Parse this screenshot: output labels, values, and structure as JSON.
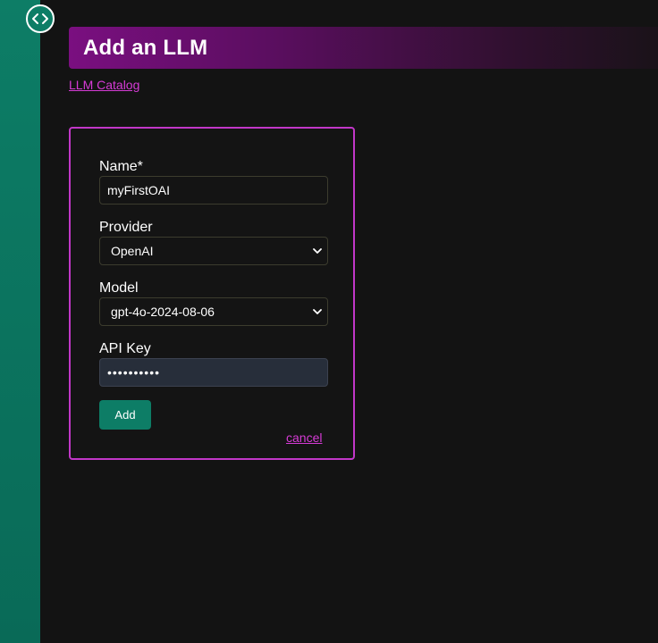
{
  "sidebar": {
    "toggle_icon": "code-brackets-icon"
  },
  "header": {
    "title": "Add an LLM"
  },
  "breadcrumb": {
    "label": "LLM Catalog"
  },
  "form": {
    "name": {
      "label": "Name*",
      "value": "myFirstOAI"
    },
    "provider": {
      "label": "Provider",
      "value": "OpenAI"
    },
    "model": {
      "label": "Model",
      "value": "gpt-4o-2024-08-06"
    },
    "api_key": {
      "label": "API Key",
      "value": "••••••••••"
    },
    "add_label": "Add",
    "cancel_label": "cancel"
  },
  "colors": {
    "accent": "#c237c8",
    "link": "#d63bd6",
    "primary": "#0d7d66",
    "background": "#131313"
  }
}
